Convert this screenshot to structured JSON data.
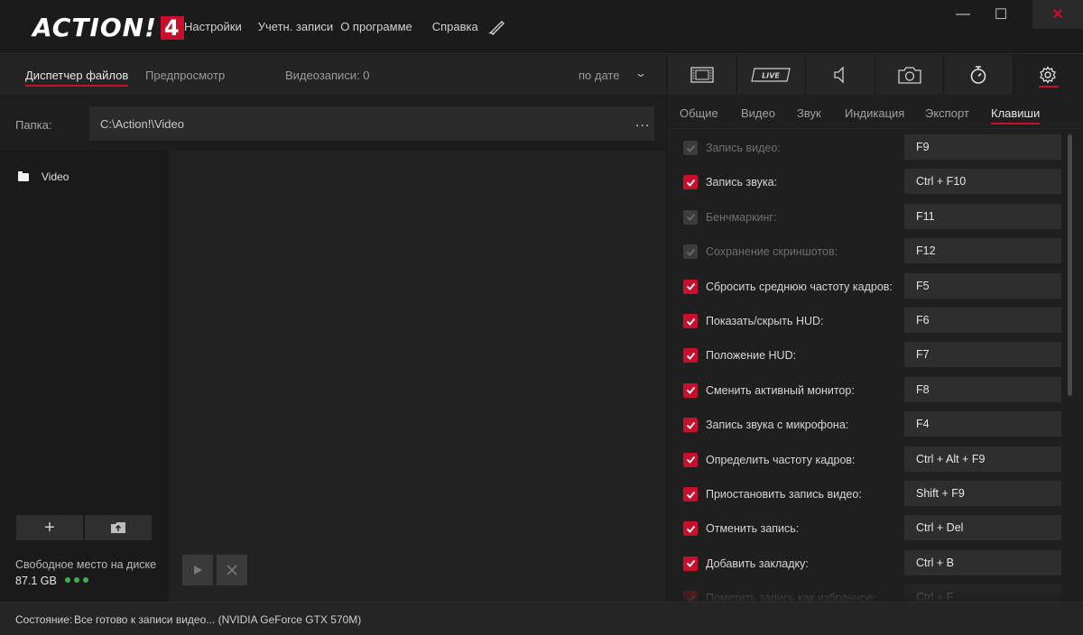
{
  "app": {
    "logo_text": "ACTION!",
    "logo_number": "4",
    "menu": [
      "Настройки",
      "Учетн. записи",
      "О программе",
      "Справка"
    ],
    "window_controls": {
      "minimize": "—",
      "maximize": "☐",
      "close": "✕"
    }
  },
  "left": {
    "tabs": [
      "Диспетчер файлов",
      "Предпросмотр"
    ],
    "active_tab": "Диспетчер файлов",
    "record_count": "Видеозаписи: 0",
    "sort": "по дате",
    "folder_label": "Папка:",
    "folder_path": "C:\\Action!\\Video",
    "folder_browse": "...",
    "tree_items": [
      "Video"
    ],
    "add_button": "+",
    "free_space_label": "Свободное место на диске",
    "free_space_value": "87.1 GB"
  },
  "right": {
    "icon_tabs": [
      "film-icon",
      "live-icon",
      "audio-icon",
      "camera-icon",
      "timer-icon",
      "gear-icon"
    ],
    "live_label": "LIVE",
    "settings_tabs": [
      "Общие",
      "Видео",
      "Звук",
      "Индикация",
      "Экспорт",
      "Клавиши"
    ],
    "active_settings_tab": "Клавиши",
    "hotkeys": [
      {
        "label": "Запись видео:",
        "key": "F9",
        "checked": true,
        "enabled": false
      },
      {
        "label": "Запись звука:",
        "key": "Ctrl + F10",
        "checked": true,
        "enabled": true
      },
      {
        "label": "Бенчмаркинг:",
        "key": "F11",
        "checked": true,
        "enabled": false
      },
      {
        "label": "Сохранение скриншотов:",
        "key": "F12",
        "checked": true,
        "enabled": false
      },
      {
        "label": "Сбросить среднюю частоту кадров:",
        "key": "F5",
        "checked": true,
        "enabled": true
      },
      {
        "label": "Показать/скрыть HUD:",
        "key": "F6",
        "checked": true,
        "enabled": true
      },
      {
        "label": "Положение HUD:",
        "key": "F7",
        "checked": true,
        "enabled": true
      },
      {
        "label": "Сменить активный монитор:",
        "key": "F8",
        "checked": true,
        "enabled": true
      },
      {
        "label": "Запись звука с микрофона:",
        "key": "F4",
        "checked": true,
        "enabled": true
      },
      {
        "label": "Определить частоту кадров:",
        "key": "Ctrl + Alt + F9",
        "checked": true,
        "enabled": true
      },
      {
        "label": "Приостановить запись видео:",
        "key": "Shift + F9",
        "checked": true,
        "enabled": true
      },
      {
        "label": "Отменить запись:",
        "key": "Ctrl + Del",
        "checked": true,
        "enabled": true
      },
      {
        "label": "Добавить закладку:",
        "key": "Ctrl + B",
        "checked": true,
        "enabled": true
      },
      {
        "label": "Пометить запись как избранное:",
        "key": "Ctrl + F",
        "checked": true,
        "enabled": true
      }
    ]
  },
  "status": {
    "label": "Состояние:",
    "text": "Все готово к записи видео...  (NVIDIA GeForce GTX 570M)"
  },
  "colors": {
    "accent": "#c8102e",
    "ok": "#3fb04b",
    "background": "#1c1c1c"
  }
}
